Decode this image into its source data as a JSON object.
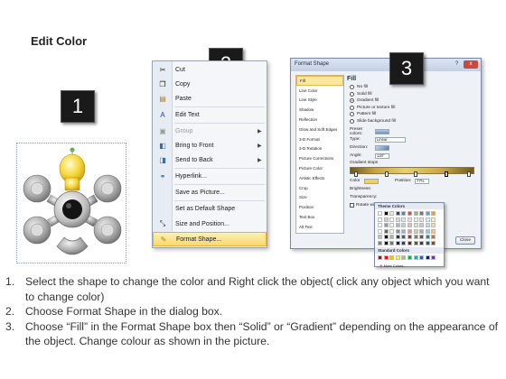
{
  "title": "Edit Color",
  "badges": [
    "1",
    "2",
    "3"
  ],
  "context_menu": {
    "items": [
      {
        "icon": "cut-icon",
        "glyph": "✂",
        "label": "Cut",
        "disabled": false,
        "arrow": false
      },
      {
        "icon": "copy-icon",
        "glyph": "❐",
        "label": "Copy",
        "disabled": false,
        "arrow": false
      },
      {
        "icon": "paste-icon",
        "glyph": "📋",
        "label": "Paste",
        "disabled": false,
        "arrow": false
      },
      {
        "icon": "edit-text-icon",
        "glyph": "A",
        "label": "Edit Text",
        "disabled": false,
        "arrow": false
      },
      {
        "icon": "group-icon",
        "glyph": "▣",
        "label": "Group",
        "disabled": true,
        "arrow": true
      },
      {
        "icon": "bring-to-front-icon",
        "glyph": "◧",
        "label": "Bring to Front",
        "disabled": false,
        "arrow": true
      },
      {
        "icon": "send-to-back-icon",
        "glyph": "◨",
        "label": "Send to Back",
        "disabled": false,
        "arrow": true
      },
      {
        "icon": "hyperlink-icon",
        "glyph": "🔗",
        "label": "Hyperlink...",
        "disabled": false,
        "arrow": false
      },
      {
        "icon": "",
        "glyph": "",
        "label": "Save as Picture...",
        "disabled": false,
        "arrow": false
      },
      {
        "icon": "",
        "glyph": "",
        "label": "Set as Default Shape",
        "disabled": false,
        "arrow": false
      },
      {
        "icon": "size-position-icon",
        "glyph": "⤡",
        "label": "Size and Position...",
        "disabled": false,
        "arrow": false
      },
      {
        "icon": "format-shape-icon",
        "glyph": "🖌",
        "label": "Format Shape...",
        "disabled": false,
        "arrow": false,
        "highlighted": true
      }
    ]
  },
  "dialog": {
    "title": "Format Shape",
    "help": "?",
    "close": "x",
    "nav_items": [
      "Fill",
      "Line Color",
      "Line Style",
      "Shadow",
      "Reflection",
      "Glow and Soft Edges",
      "3-D Format",
      "3-D Rotation",
      "Picture Corrections",
      "Picture Color",
      "Artistic Effects",
      "Crop",
      "Size",
      "Position",
      "Text Box",
      "Alt Text"
    ],
    "fill_heading": "Fill",
    "fill_options": [
      {
        "label": "No fill",
        "selected": false
      },
      {
        "label": "Solid fill",
        "selected": false
      },
      {
        "label": "Gradient fill",
        "selected": true
      },
      {
        "label": "Picture or texture fill",
        "selected": false
      },
      {
        "label": "Pattern fill",
        "selected": false
      },
      {
        "label": "Slide background fill",
        "selected": false
      }
    ],
    "preset_colors_label": "Preset colors:",
    "type_label": "Type:",
    "type_value": "Linear",
    "direction_label": "Direction:",
    "angle_label": "Angle:",
    "angle_value": "120°",
    "gradient_stops_label": "Gradient stops",
    "color_label": "Color",
    "position_label": "Position:",
    "position_value": "77%",
    "brightness_label": "Brightness:",
    "transparency_label": "Transparency:",
    "rotate_label": "Rotate with shape",
    "close_button": "Close"
  },
  "color_picker": {
    "theme_heading": "Theme Colors",
    "standard_heading": "Standard Colors",
    "more_colors": "More Colors...",
    "theme_columns": [
      "#ffffff",
      "#000000",
      "#eeece1",
      "#1f497d",
      "#4f81bd",
      "#c0504d",
      "#9bbb59",
      "#8064a2",
      "#4bacc6",
      "#f79646"
    ],
    "standard_colors": [
      "#c00000",
      "#ff0000",
      "#ffc000",
      "#ffff00",
      "#92d050",
      "#00b050",
      "#00b0f0",
      "#0070c0",
      "#002060",
      "#7030a0"
    ]
  },
  "steps": [
    {
      "num": "1.",
      "text": "Select the shape to change the color and Right click the object( click any object which you want to change color)"
    },
    {
      "num": "2.",
      "text": "Choose Format Shape in the dialog box."
    },
    {
      "num": "3.",
      "text": "Choose “Fill” in the Format Shape box then “Solid” or “Gradient” depending on the appearance of the object. Change colour as shown in the picture."
    }
  ]
}
